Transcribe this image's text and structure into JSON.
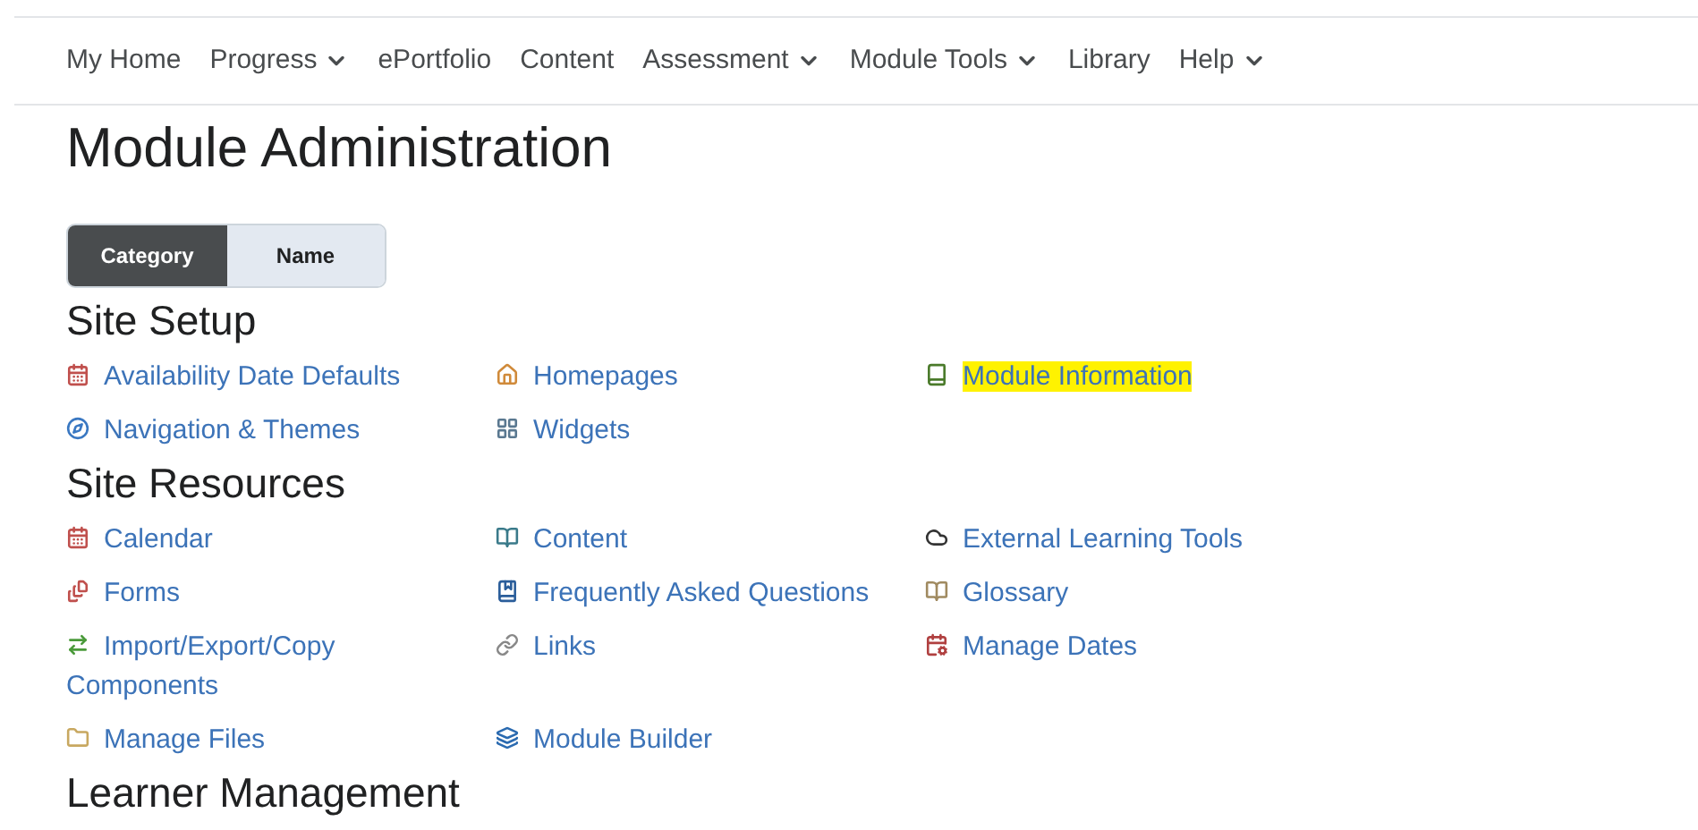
{
  "nav": [
    {
      "label": "My Home",
      "dropdown": false
    },
    {
      "label": "Progress",
      "dropdown": true
    },
    {
      "label": "ePortfolio",
      "dropdown": false
    },
    {
      "label": "Content",
      "dropdown": false
    },
    {
      "label": "Assessment",
      "dropdown": true
    },
    {
      "label": "Module Tools",
      "dropdown": true
    },
    {
      "label": "Library",
      "dropdown": false
    },
    {
      "label": "Help",
      "dropdown": true
    }
  ],
  "title": "Module Administration",
  "view_toggle": [
    {
      "label": "Category",
      "selected": true
    },
    {
      "label": "Name",
      "selected": false
    }
  ],
  "sections": [
    {
      "title": "Site Setup",
      "items": [
        {
          "label": "Availability Date Defaults",
          "highlighted": false
        },
        {
          "label": "Homepages",
          "highlighted": false
        },
        {
          "label": "Module Information",
          "highlighted": true
        },
        {
          "label": "Navigation & Themes",
          "highlighted": false
        },
        {
          "label": "Widgets",
          "highlighted": false
        }
      ]
    },
    {
      "title": "Site Resources",
      "items": [
        {
          "label": "Calendar",
          "highlighted": false
        },
        {
          "label": "Content",
          "highlighted": false
        },
        {
          "label": "External Learning Tools",
          "highlighted": false
        },
        {
          "label": "Forms",
          "highlighted": false
        },
        {
          "label": "Frequently Asked Questions",
          "highlighted": false
        },
        {
          "label": "Glossary",
          "highlighted": false
        },
        {
          "label": "Import/Export/Copy Components",
          "highlighted": false
        },
        {
          "label": "Links",
          "highlighted": false
        },
        {
          "label": "Manage Dates",
          "highlighted": false
        },
        {
          "label": "Manage Files",
          "highlighted": false
        },
        {
          "label": "Module Builder",
          "highlighted": false
        }
      ]
    },
    {
      "title": "Learner Management"
    }
  ]
}
